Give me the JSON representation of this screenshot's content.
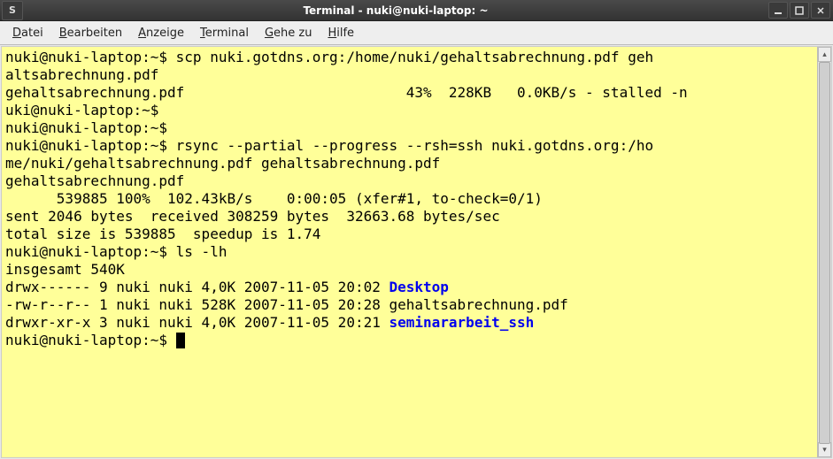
{
  "titlebar": {
    "sysmenu": "S",
    "title": "Terminal - nuki@nuki-laptop: ~"
  },
  "menubar": {
    "items": [
      {
        "ul": "D",
        "rest": "atei"
      },
      {
        "ul": "B",
        "rest": "earbeiten"
      },
      {
        "ul": "A",
        "rest": "nzeige"
      },
      {
        "ul": "T",
        "rest": "erminal"
      },
      {
        "ul": "G",
        "rest": "ehe zu"
      },
      {
        "ul": "H",
        "rest": "ilfe"
      }
    ]
  },
  "terminal": {
    "lines": [
      {
        "t": "nuki@nuki-laptop:~$ scp nuki.gotdns.org:/home/nuki/gehaltsabrechnung.pdf geh"
      },
      {
        "t": "altsabrechnung.pdf"
      },
      {
        "t": "gehaltsabrechnung.pdf                          43%  228KB   0.0KB/s - stalled -n"
      },
      {
        "t": "uki@nuki-laptop:~$"
      },
      {
        "t": "nuki@nuki-laptop:~$"
      },
      {
        "t": "nuki@nuki-laptop:~$ rsync --partial --progress --rsh=ssh nuki.gotdns.org:/ho"
      },
      {
        "t": "me/nuki/gehaltsabrechnung.pdf gehaltsabrechnung.pdf"
      },
      {
        "t": "gehaltsabrechnung.pdf"
      },
      {
        "t": "      539885 100%  102.43kB/s    0:00:05 (xfer#1, to-check=0/1)"
      },
      {
        "t": ""
      },
      {
        "t": "sent 2046 bytes  received 308259 bytes  32663.68 bytes/sec"
      },
      {
        "t": "total size is 539885  speedup is 1.74"
      },
      {
        "t": "nuki@nuki-laptop:~$ ls -lh"
      },
      {
        "t": "insgesamt 540K"
      },
      {
        "t": "drwx------ 9 nuki nuki 4,0K 2007-11-05 20:02 ",
        "blue": "Desktop"
      },
      {
        "t": "-rw-r--r-- 1 nuki nuki 528K 2007-11-05 20:28 gehaltsabrechnung.pdf"
      },
      {
        "t": "drwxr-xr-x 3 nuki nuki 4,0K 2007-11-05 20:21 ",
        "blue": "seminararbeit_ssh"
      },
      {
        "t": "nuki@nuki-laptop:~$ ",
        "cursor": true
      }
    ]
  },
  "colors": {
    "terminal_bg": "#ffff99",
    "dir_blue": "#0000ee"
  }
}
